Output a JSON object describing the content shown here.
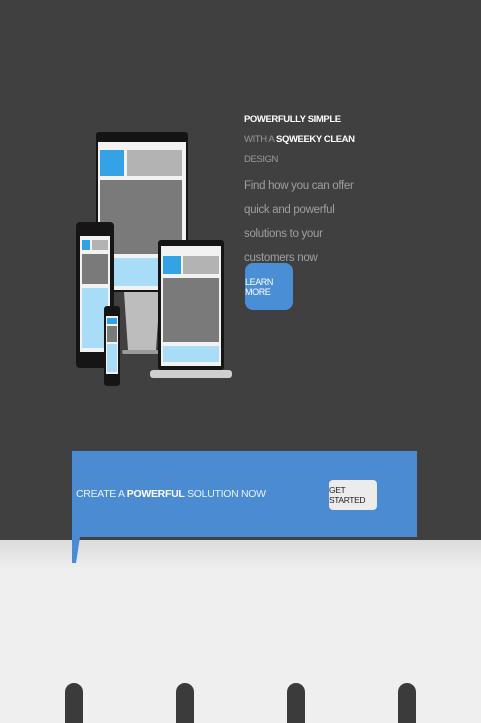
{
  "hero": {
    "heading": {
      "part1": "POWERFULLY SIMPLE",
      "part2": " WITH A ",
      "part3": "SQWEEKY CLEAN",
      "part4": " DESIGN"
    },
    "tagline": "Find how you can offer quick and powerful solutions to your customers now",
    "learn_more_label": "LEARN MORE"
  },
  "banner": {
    "text_part1": "CREATE A ",
    "text_bold": "POWERFUL",
    "text_part2": " SOLUTION NOW",
    "get_started_label": "GET STARTED"
  },
  "colors": {
    "hero_bg": "#404040",
    "accent_blue": "#4a8bd1",
    "page_bg": "#efefef"
  }
}
